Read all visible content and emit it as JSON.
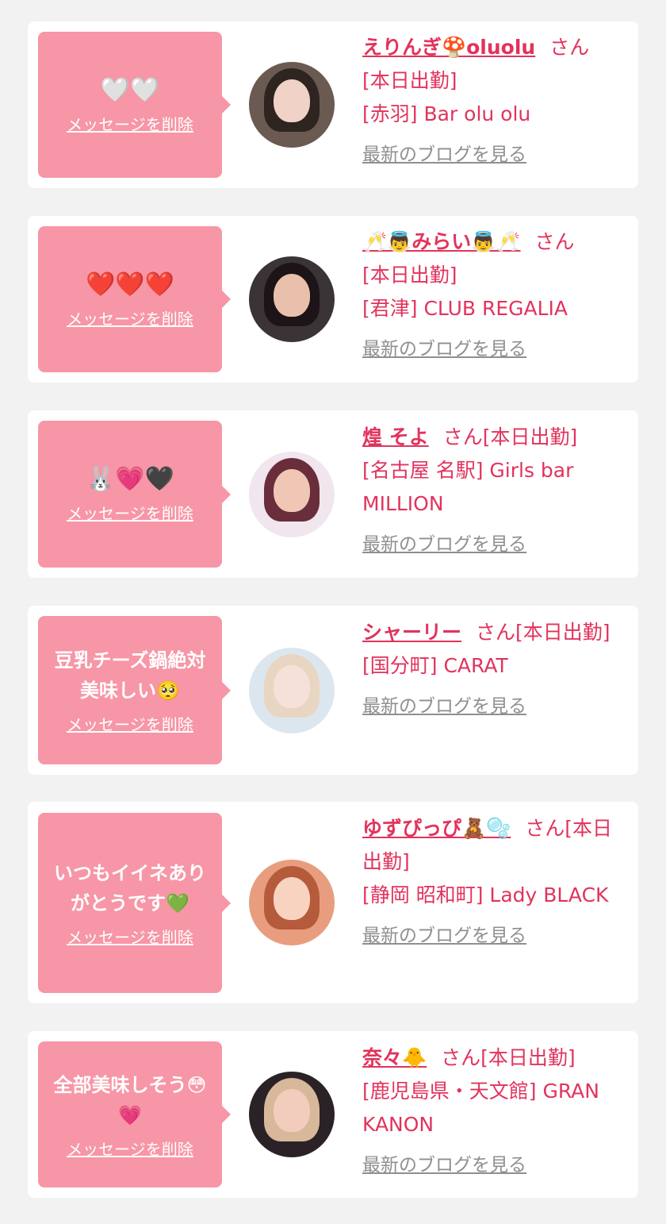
{
  "delete_label": "メッセージを削除",
  "blog_label": "最新のブログを見る",
  "honorific": "さん",
  "status": "[本日出勤]",
  "items": [
    {
      "message": "🤍🤍",
      "name": "えりんぎ🍄oluolu",
      "shop": "[赤羽] Bar olu olu",
      "avatar_colors": {
        "bg": "#6b5a52",
        "hair": "#2e2420",
        "face": "#f1d2c6"
      }
    },
    {
      "message": "❤️❤️❤️",
      "name": "🥂👼みらい👼🥂",
      "shop": "[君津] CLUB REGALIA",
      "avatar_colors": {
        "bg": "#3a3436",
        "hair": "#1c1416",
        "face": "#e9c0ab"
      }
    },
    {
      "message": "🐰💗🖤",
      "name": "煌 そよ",
      "shop": "[名古屋 名駅] Girls bar MILLION",
      "avatar_colors": {
        "bg": "#f1e6ee",
        "hair": "#6a2d3b",
        "face": "#f0c7b5"
      }
    },
    {
      "message": "豆乳チーズ鍋絶対美味しい🥺",
      "name": "シャーリー",
      "shop": "[国分町] CARAT",
      "avatar_colors": {
        "bg": "#dce6ee",
        "hair": "#e9d6c2",
        "face": "#f6e1d8"
      }
    },
    {
      "message": "いつもイイネありがとうです💚",
      "name": "ゆずぴっぴ🧸🫧",
      "shop": "[静岡 昭和町] Lady BLACK",
      "avatar_colors": {
        "bg": "#e89e7e",
        "hair": "#b55b3c",
        "face": "#f8d3c0"
      }
    },
    {
      "message": "全部美味しそう😳💗",
      "name": "奈々🐥",
      "shop": "[鹿児島県・天文館] GRAN KANON",
      "avatar_colors": {
        "bg": "#2a2226",
        "hair": "#d7b89a",
        "face": "#f2cdbd"
      }
    }
  ]
}
